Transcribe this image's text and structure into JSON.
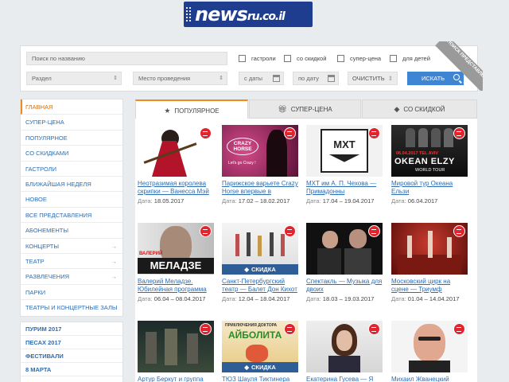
{
  "logo": {
    "main": "news",
    "suffix": "ru.co.il"
  },
  "search": {
    "name_placeholder": "Поиск по названию",
    "section_placeholder": "Раздел",
    "venue_placeholder": "Место проведения",
    "from_placeholder": "с даты",
    "to_placeholder": "по дату",
    "clear_label": "ОЧИСТИТЬ",
    "search_label": "ИСКАТЬ",
    "checkboxes": [
      "гастроли",
      "со скидкой",
      "супер-цена",
      "для детей"
    ],
    "ribbon": "ПОИСК ПРЕДСТАВЛЕНИЙ"
  },
  "sidebar": {
    "items": [
      {
        "label": "ГЛАВНАЯ"
      },
      {
        "label": "СУПЕР-ЦЕНА"
      },
      {
        "label": "ПОПУЛЯРНОЕ"
      },
      {
        "label": "СО СКИДКАМИ"
      },
      {
        "label": "ГАСТРОЛИ"
      },
      {
        "label": "БЛИЖАЙШАЯ НЕДЕЛЯ"
      },
      {
        "label": "НОВОЕ"
      },
      {
        "label": "ВСЕ ПРЕДСТАВЛЕНИЯ"
      },
      {
        "label": "АБОНЕМЕНТЫ"
      },
      {
        "label": "КОНЦЕРТЫ"
      },
      {
        "label": "ТЕАТР"
      },
      {
        "label": "РАЗВЛЕЧЕНИЯ"
      },
      {
        "label": "ПАРКИ"
      },
      {
        "label": "ТЕАТРЫ И КОНЦЕРТНЫЕ ЗАЛЫ"
      }
    ],
    "holidays": [
      "ПУРИМ 2017",
      "ПЕСАХ 2017",
      "ФЕСТИВАЛИ",
      "8 МАРТА"
    ]
  },
  "tabs": [
    {
      "label": "ПОПУЛЯРНОЕ",
      "icon": "star-icon"
    },
    {
      "label": "СУПЕР-ЦЕНА",
      "icon": "gift-icon"
    },
    {
      "label": "СО СКИДКОЙ",
      "icon": "tag-icon"
    }
  ],
  "cards": [
    {
      "title": "Неотразимая королева скрипки — Ванесса Мэй",
      "date_label": "Дата:",
      "date": "18.05.2017",
      "discount": ""
    },
    {
      "title": "Парижское варьете Crazy Horse впервые в Израиле!",
      "date_label": "Дата:",
      "date": "17.02 – 18.02.2017",
      "discount": ""
    },
    {
      "title": "МХТ им А. П. Чехова — Примадонны",
      "date_label": "Дата:",
      "date": "17.04 – 19.04.2017",
      "discount": ""
    },
    {
      "title": "Мировой тур Океана Ельзи",
      "date_label": "Дата:",
      "date": "06.04.2017",
      "discount": ""
    },
    {
      "title": "Валерий Меладзе. Юбилейная программа",
      "date_label": "Дата:",
      "date": "06.04 – 08.04.2017",
      "discount": ""
    },
    {
      "title": "Санкт-Петербургский театр — Балет Дон Кихот",
      "date_label": "Дата:",
      "date": "12.04 – 18.04.2017",
      "discount": "СКИДКА"
    },
    {
      "title": "Спектакль — Музыка для двоих",
      "date_label": "Дата:",
      "date": "18.03 – 19.03.2017",
      "discount": ""
    },
    {
      "title": "Московский цирк на сцене — Триумф",
      "date_label": "Дата:",
      "date": "01.04 – 14.04.2017",
      "discount": ""
    },
    {
      "title": "Артур Беркут и группа",
      "date_label": "",
      "date": "",
      "discount": ""
    },
    {
      "title": "ТЮЗ Шауля Тиктинера",
      "date_label": "",
      "date": "",
      "discount": "СКИДКА"
    },
    {
      "title": "Екатерина Гусева — Я",
      "date_label": "",
      "date": "",
      "discount": ""
    },
    {
      "title": "Михаил Жванецкий",
      "date_label": "",
      "date": "",
      "discount": ""
    }
  ],
  "thumb_text": {
    "crazy_horse": "CRAZY HORSE",
    "crazy_sub": "Let's go Crazy !",
    "mxt": "МХТ",
    "okean_date": "06.04.2017 TEL AVIV",
    "okean": "OKEAN ELZY",
    "okean_sub": "WORLD TOUR",
    "meladze_1": "ВАЛЕРИЙ",
    "meladze_2": "МЕЛАДЗЕ",
    "afisha_1": "ПРИКЛЮЧЕНИЯ ДОКТОРА",
    "afisha_2": "АЙБОЛИТА"
  },
  "colors": {
    "accent": "#f08a1a",
    "link": "#2c6cb3",
    "search_btn": "#3e85d3",
    "discount": "#2f5e97",
    "badge": "#e2242e"
  }
}
